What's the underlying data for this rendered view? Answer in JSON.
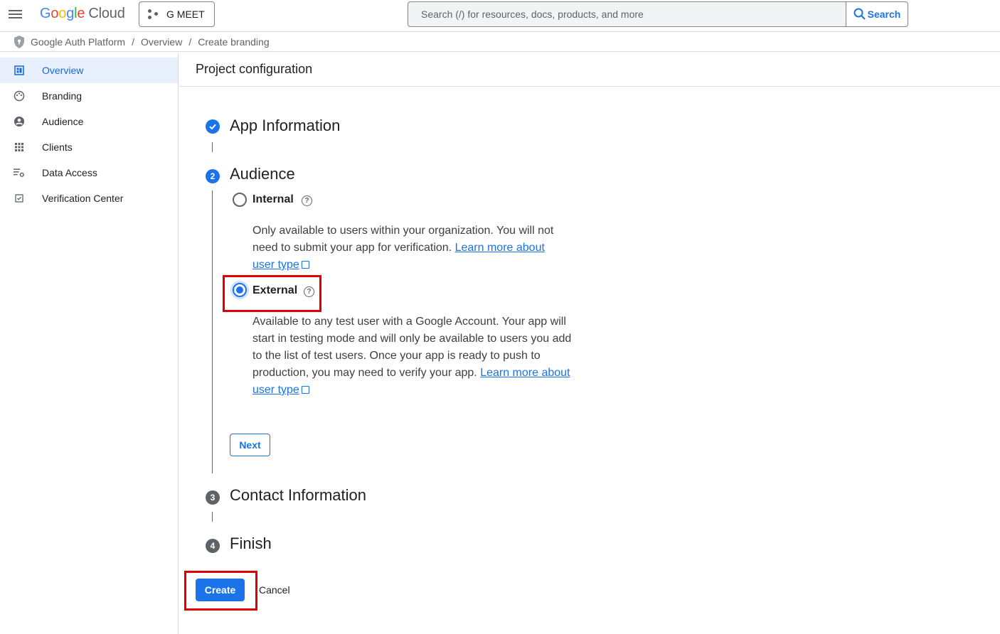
{
  "topbar": {
    "logo": {
      "g1": "G",
      "g2": "o",
      "g3": "o",
      "g4": "g",
      "g5": "l",
      "g6": "e",
      "cloud": "Cloud"
    },
    "project_label": "G MEET",
    "search_placeholder": "Search (/) for resources, docs, products, and more",
    "search_button": "Search",
    "icons": {
      "menu": "menu-icon",
      "project": "project-nodes-icon",
      "search": "search-icon"
    }
  },
  "breadcrumb": {
    "items": [
      "Google Auth Platform",
      "Overview",
      "Create branding"
    ],
    "separator": "/"
  },
  "sidebar": {
    "items": [
      {
        "label": "Overview",
        "icon": "dashboard-icon",
        "active": true
      },
      {
        "label": "Branding",
        "icon": "palette-icon",
        "active": false
      },
      {
        "label": "Audience",
        "icon": "person-icon",
        "active": false
      },
      {
        "label": "Clients",
        "icon": "apps-grid-icon",
        "active": false
      },
      {
        "label": "Data Access",
        "icon": "list-settings-icon",
        "active": false
      },
      {
        "label": "Verification Center",
        "icon": "checkbox-icon",
        "active": false
      }
    ]
  },
  "main": {
    "title": "Project configuration",
    "steps": [
      {
        "number": "1",
        "title": "App Information",
        "status": "complete"
      },
      {
        "number": "2",
        "title": "Audience",
        "status": "active"
      },
      {
        "number": "3",
        "title": "Contact Information",
        "status": "pending"
      },
      {
        "number": "4",
        "title": "Finish",
        "status": "pending"
      }
    ],
    "audience": {
      "options": [
        {
          "label": "Internal",
          "selected": false,
          "help": "?",
          "description": "Only available to users within your organization. You will not need to submit your app for verification.",
          "link_part1": "Learn more about",
          "link_part2": "user type"
        },
        {
          "label": "External",
          "selected": true,
          "help": "?",
          "description": "Available to any test user with a Google Account. Your app will start in testing mode and will only be available to users you add to the list of test users. Once your app is ready to push to production, you may need to verify your app.",
          "link_part1": "Learn more about",
          "link_part2": "user type"
        }
      ],
      "next_button": "Next"
    },
    "create_button": "Create",
    "cancel_button": "Cancel"
  },
  "colors": {
    "accent": "#1a73e8",
    "highlight": "#e00000",
    "active_nav_bg": "#e8f0fe",
    "pending_step": "#5f6368"
  }
}
